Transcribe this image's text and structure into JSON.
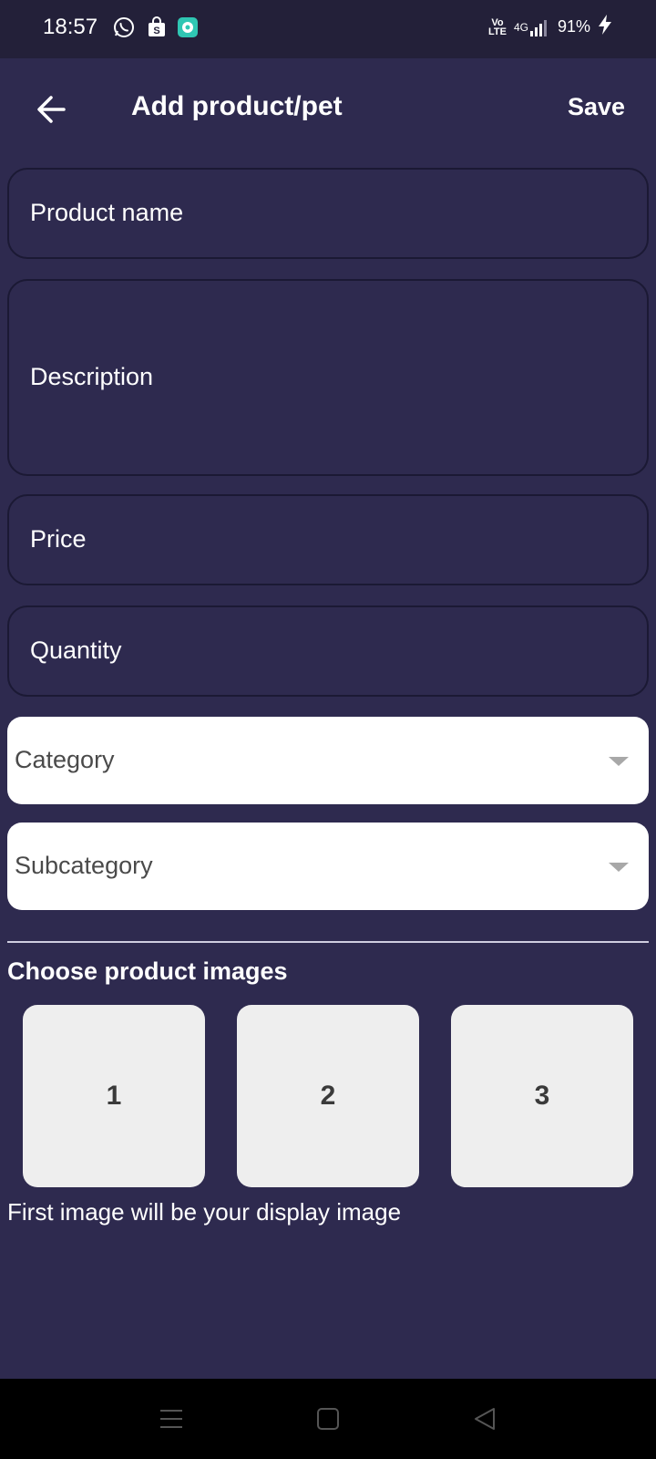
{
  "status_bar": {
    "time": "18:57",
    "volte_top": "Vo",
    "volte_bottom": "LTE",
    "network": "4G",
    "battery": "91%",
    "icons": [
      "whatsapp-icon",
      "shopping-bag-icon",
      "app-notification-icon",
      "signal-icon",
      "battery-charging-icon"
    ]
  },
  "app_bar": {
    "title": "Add product/pet",
    "save_label": "Save"
  },
  "form": {
    "product_name_label": "Product name",
    "description_label": "Description",
    "price_label": "Price",
    "quantity_label": "Quantity",
    "category_label": "Category",
    "subcategory_label": "Subcategory"
  },
  "images": {
    "section_title": "Choose product images",
    "slots": [
      "1",
      "2",
      "3"
    ],
    "hint": "First image will be your display image"
  },
  "colors": {
    "background": "#2e2a4f",
    "status_bar": "#232039",
    "field_border": "#1b1934",
    "dropdown_bg": "#ffffff",
    "image_slot_bg": "#eeeeee"
  }
}
